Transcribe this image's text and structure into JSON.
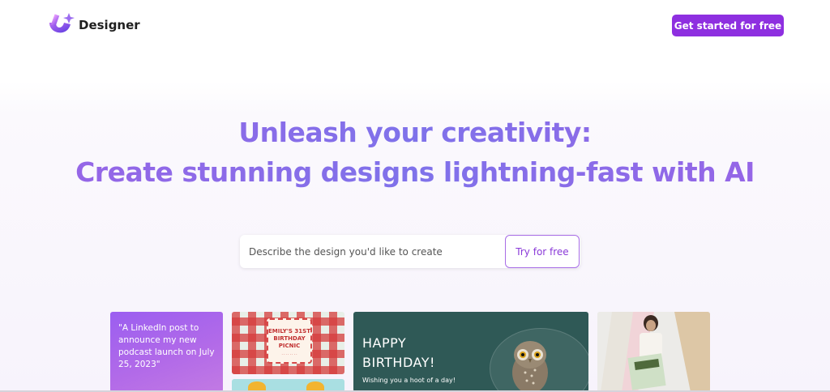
{
  "header": {
    "brand": "Designer",
    "cta_label": "Get started for free"
  },
  "hero": {
    "line1": "Unleash your creativity:",
    "line2": "Create stunning designs lightning-fast with AI"
  },
  "prompt": {
    "placeholder": "Describe the design you'd like to create",
    "button_label": "Try for free"
  },
  "gallery": {
    "linkedin_card_text": "\"A LinkedIn post to announce my new podcast launch on July 25, 2023\"",
    "picnic_title": "EMILY'S 31ST BIRTHDAY PICNIC",
    "birthday_line1": "HAPPY",
    "birthday_line2": "BIRTHDAY!",
    "birthday_sub": "Wishing you a hoot of a day!"
  },
  "colors": {
    "accent": "#8e2fe0",
    "hero_gradient_start": "#9a63e6",
    "hero_gradient_mid": "#7f72ea",
    "birthday_card_bg": "#2f5956"
  },
  "icons": {
    "logo": "designer-logo-icon"
  }
}
